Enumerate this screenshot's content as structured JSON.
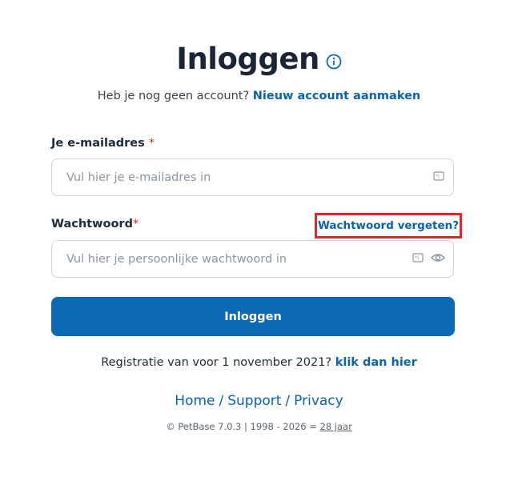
{
  "header": {
    "title": "Inloggen",
    "subtitle_text": "Heb je nog geen account?",
    "create_account_link": "Nieuw account aanmaken"
  },
  "form": {
    "email": {
      "label": "Je e-mailadres",
      "required_mark": "*",
      "placeholder": "Vul hier je e-mailadres in",
      "value": ""
    },
    "password": {
      "label": "Wachtwoord",
      "required_mark": "*",
      "placeholder": "Vul hier je persoonlijke wachtwoord in",
      "value": ""
    },
    "forgot_password_link": "Wachtwoord vergeten?",
    "submit_label": "Inloggen"
  },
  "register": {
    "text": "Registratie van voor 1 november 2021?",
    "link": "klik dan hier"
  },
  "footer": {
    "links": [
      "Home",
      "Support",
      "Privacy"
    ],
    "separator": "/",
    "copyright_text": "© PetBase 7.0.3 | 1998 - 2026 =",
    "years_link": "28 jaar"
  },
  "icons": {
    "info": "info-circle-icon",
    "email_field": "autofill-card-icon",
    "password_field": "autofill-card-icon",
    "password_toggle": "eye-icon"
  },
  "colors": {
    "accent": "#0c69b4",
    "link": "#0a64ad",
    "required": "#e02b2b",
    "highlight_border": "#e0262b"
  }
}
